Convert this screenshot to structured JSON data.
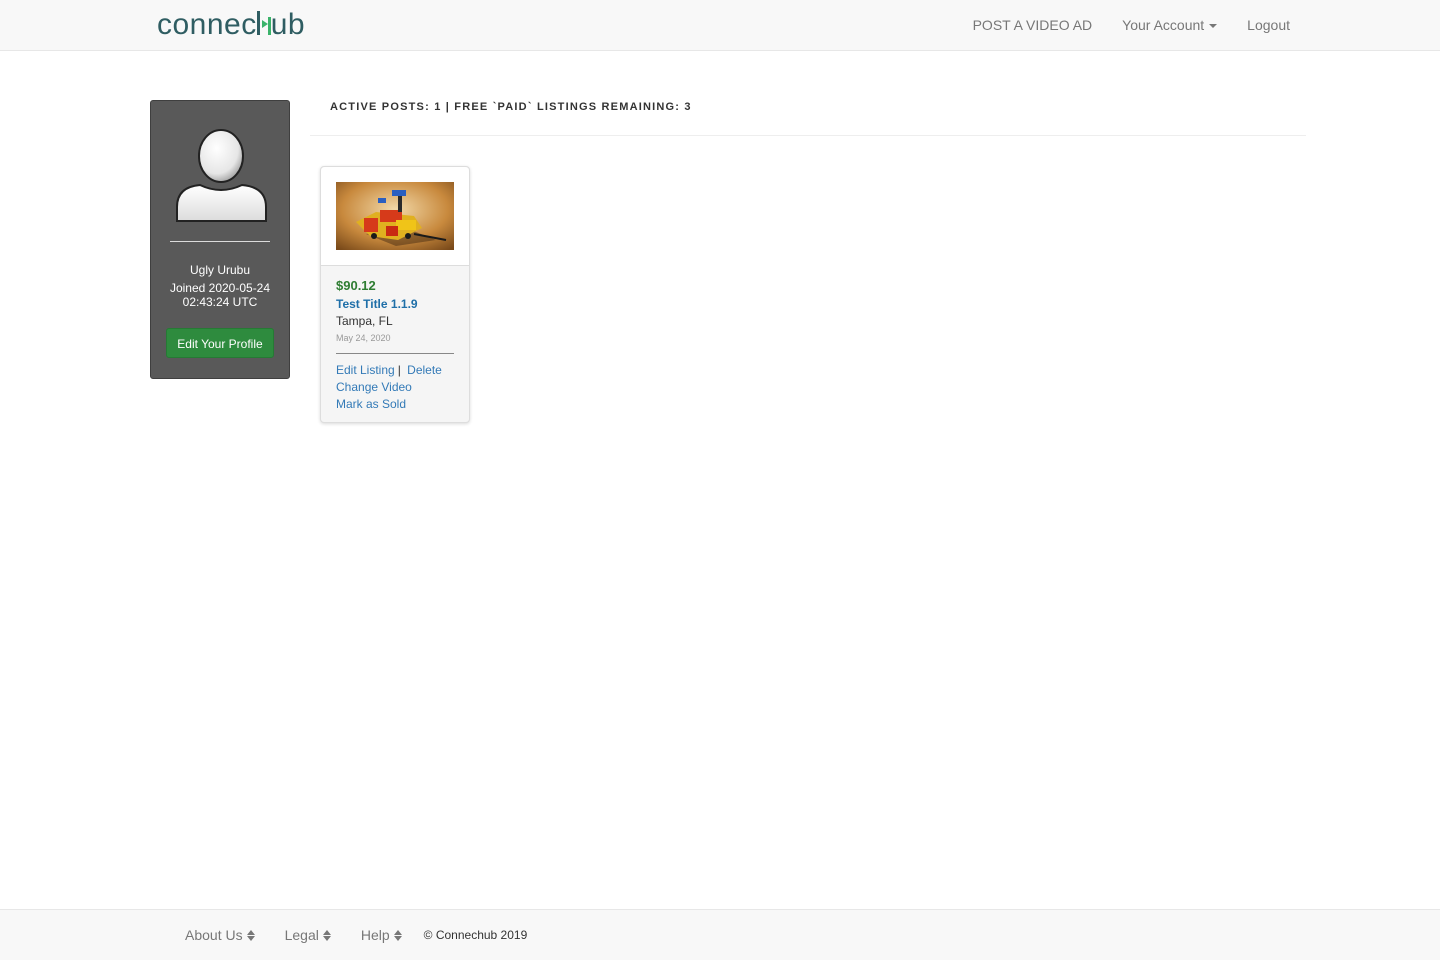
{
  "navbar": {
    "logo_text": "connechub",
    "logo_part1": "connec",
    "logo_part2": "ub",
    "links": [
      {
        "label": "POST A VIDEO AD"
      },
      {
        "label": "Your Account"
      },
      {
        "label": "Logout"
      }
    ]
  },
  "profile": {
    "name": "Ugly Urubu",
    "joined": "Joined 2020-05-24 02:43:24 UTC",
    "edit_button": "Edit Your Profile"
  },
  "posts_header": "ACTIVE POSTS: 1 | FREE `PAID` LISTINGS REMAINING: 3",
  "listing": {
    "price": "$90.12",
    "title": "Test Title 1.1.9",
    "location": "Tampa, FL",
    "date": "May 24, 2020",
    "actions": {
      "edit": "Edit Listing",
      "separator": "|",
      "delete": "Delete",
      "change_video": "Change Video",
      "mark_sold": "Mark as Sold"
    }
  },
  "footer": {
    "links": [
      {
        "label": "About Us"
      },
      {
        "label": "Legal"
      },
      {
        "label": "Help"
      }
    ],
    "copyright": "© Connechub 2019"
  },
  "colors": {
    "brand_dark": "#2f5d62",
    "brand_green": "#3ab36a",
    "button_green": "#2e8b3e",
    "link_blue": "#337ab7"
  }
}
